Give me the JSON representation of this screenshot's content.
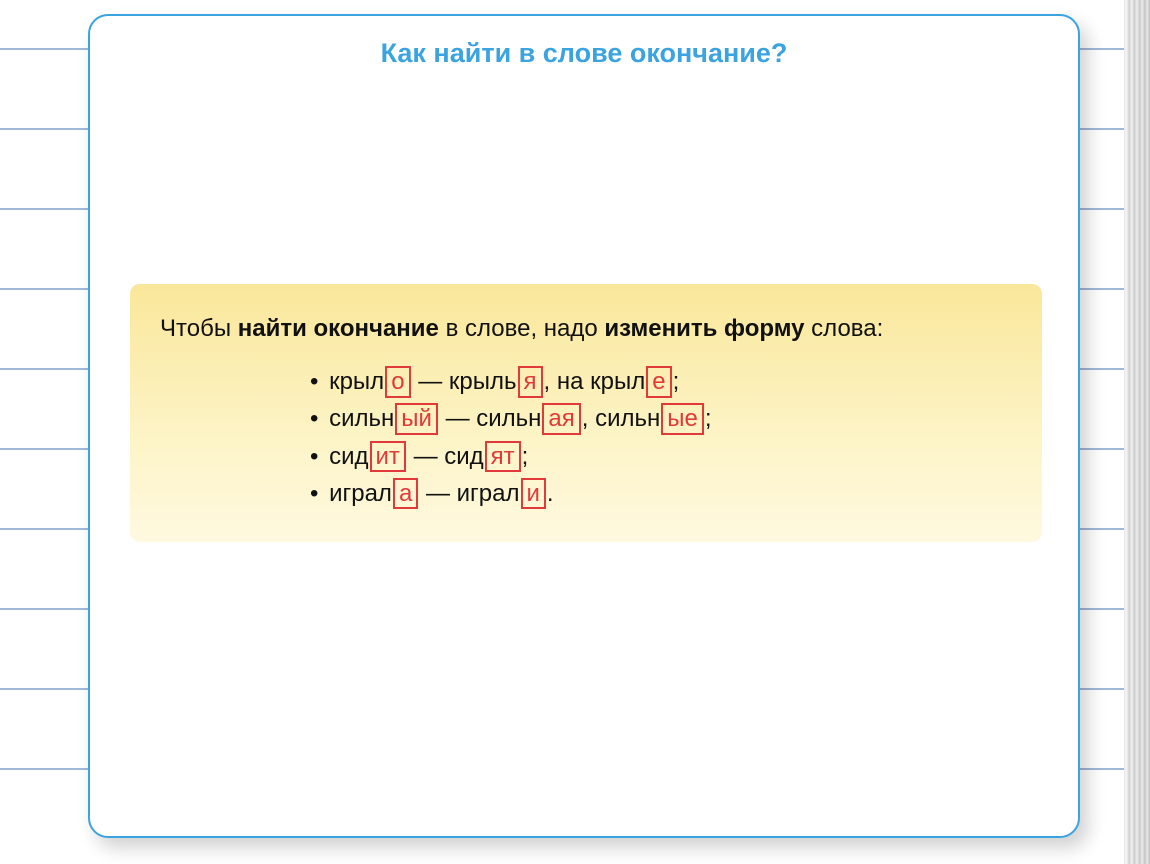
{
  "title": "Как найти в слове окончание?",
  "intro": {
    "p1": "Чтобы ",
    "b1": "найти окончание",
    "p2": " в слове, надо ",
    "b2": "изменить форму",
    "p3": " слова:"
  },
  "examples": [
    {
      "bullet": "•",
      "segs": [
        {
          "t": "text",
          "v": "крыл"
        },
        {
          "t": "end",
          "v": "о"
        },
        {
          "t": "text",
          "v": " — крыль"
        },
        {
          "t": "end",
          "v": "я"
        },
        {
          "t": "text",
          "v": ", на крыл"
        },
        {
          "t": "end",
          "v": "е"
        },
        {
          "t": "text",
          "v": ";"
        }
      ]
    },
    {
      "bullet": "•",
      "segs": [
        {
          "t": "text",
          "v": "сильн"
        },
        {
          "t": "end",
          "v": "ый"
        },
        {
          "t": "text",
          "v": " — сильн"
        },
        {
          "t": "end",
          "v": "ая"
        },
        {
          "t": "text",
          "v": ", сильн"
        },
        {
          "t": "end",
          "v": "ые"
        },
        {
          "t": "text",
          "v": ";"
        }
      ]
    },
    {
      "bullet": "•",
      "segs": [
        {
          "t": "text",
          "v": "сид"
        },
        {
          "t": "end",
          "v": "ит"
        },
        {
          "t": "text",
          "v": " — сид"
        },
        {
          "t": "end",
          "v": "ят"
        },
        {
          "t": "text",
          "v": ";"
        }
      ]
    },
    {
      "bullet": "•",
      "segs": [
        {
          "t": "text",
          "v": "играл"
        },
        {
          "t": "end",
          "v": "а"
        },
        {
          "t": "text",
          "v": " — играл"
        },
        {
          "t": "end",
          "v": "и"
        },
        {
          "t": "text",
          "v": "."
        }
      ]
    }
  ]
}
